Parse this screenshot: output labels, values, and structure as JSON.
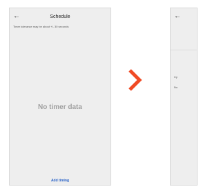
{
  "screen": {
    "back_icon_glyph": "←",
    "title": "Schedule",
    "tolerance_note": "Timer tolerance may be about +/- 30 seconds",
    "empty_message": "No timer data",
    "add_button": "Add timing"
  },
  "arrow": {
    "icon": "chevron-right",
    "color": "#f04a24"
  },
  "next_screen": {
    "back_icon_glyph": "←",
    "text_1": "Cy",
    "text_2": "Nu"
  }
}
